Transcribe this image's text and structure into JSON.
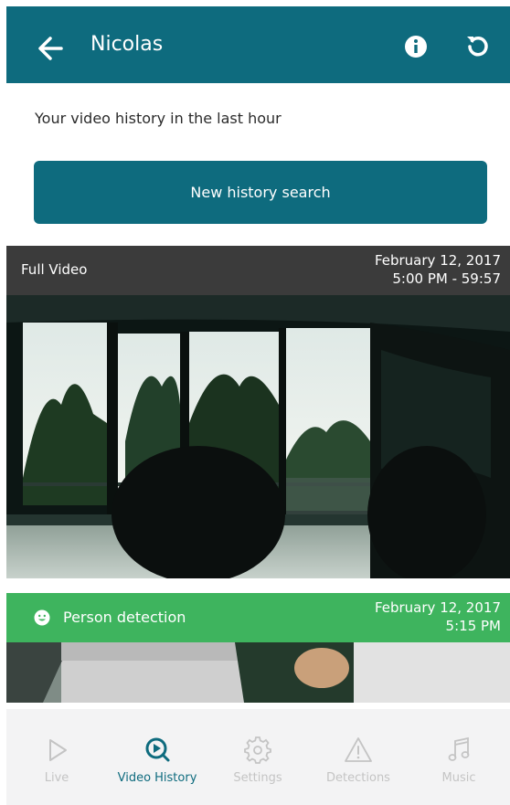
{
  "header": {
    "title": "Nicolas",
    "icons": {
      "back": "arrow-left-icon",
      "info": "info-icon",
      "refresh": "refresh-icon"
    }
  },
  "subtitle": "Your video history in the last hour",
  "search_button": {
    "label": "New history search"
  },
  "cards": [
    {
      "label": "Full Video",
      "date_line1": "February 12, 2017",
      "date_line2": "5:00 PM - 59:57"
    },
    {
      "label": "Person detection",
      "icon": "smiley-face-icon",
      "date_line1": "February 12, 2017",
      "date_line2": "5:15 PM"
    }
  ],
  "nav": {
    "items": [
      {
        "label": "Live",
        "icon": "play-icon",
        "active": false
      },
      {
        "label": "Video History",
        "icon": "history-play-icon",
        "active": true
      },
      {
        "label": "Settings",
        "icon": "gear-icon",
        "active": false
      },
      {
        "label": "Detections",
        "icon": "warning-icon",
        "active": false
      },
      {
        "label": "Music",
        "icon": "music-note-icon",
        "active": false
      }
    ]
  },
  "colors": {
    "primary": "#0e6b7e",
    "detection_green": "#3eb45e",
    "video_bar": "#3b3b3b",
    "nav_bg": "#f3f3f4",
    "nav_inactive": "#c4c4c4"
  }
}
